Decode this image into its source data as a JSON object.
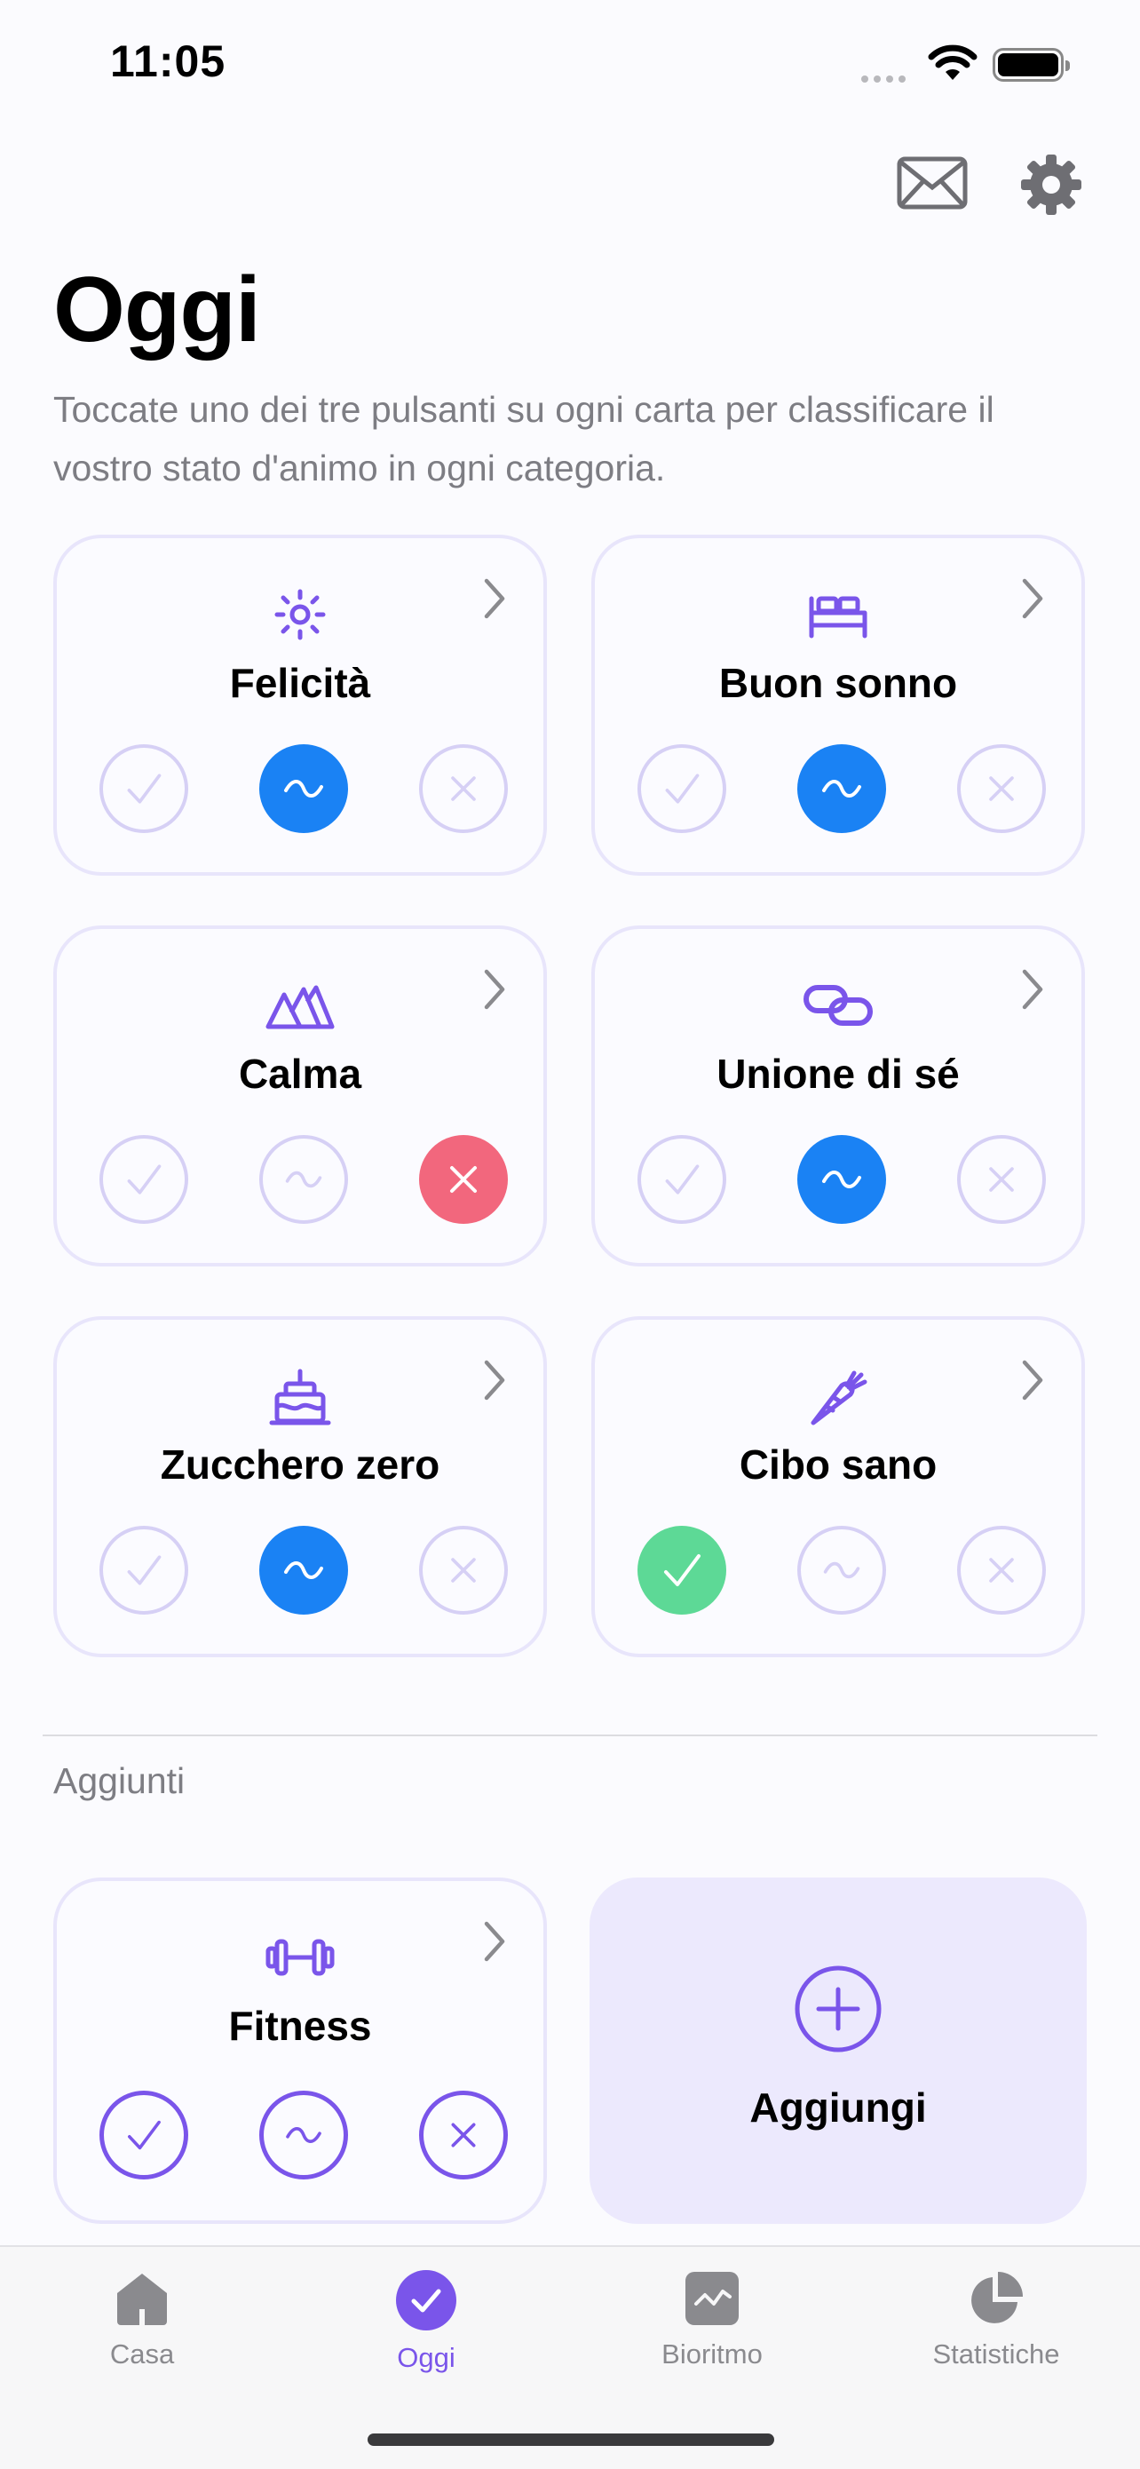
{
  "status_bar": {
    "time": "11:05"
  },
  "header": {
    "title": "Oggi",
    "subtitle": "Toccate uno dei tre pulsanti su ogni carta per classificare il vostro stato d'animo in ogni categoria."
  },
  "cards": [
    {
      "name": "Felicità",
      "icon": "sun-icon",
      "selected": "neutral"
    },
    {
      "name": "Buon sonno",
      "icon": "bed-icon",
      "selected": "neutral"
    },
    {
      "name": "Calma",
      "icon": "mountains-icon",
      "selected": "no"
    },
    {
      "name": "Unione di sé",
      "icon": "link-icon",
      "selected": "neutral"
    },
    {
      "name": "Zucchero zero",
      "icon": "cake-icon",
      "selected": "neutral"
    },
    {
      "name": "Cibo sano",
      "icon": "carrot-icon",
      "selected": "yes"
    }
  ],
  "added_section": {
    "label": "Aggiunti",
    "cards": [
      {
        "name": "Fitness",
        "icon": "dumbbell-icon",
        "selected": "none"
      }
    ],
    "add_label": "Aggiungi"
  },
  "tabbar": {
    "tabs": [
      {
        "label": "Casa",
        "icon": "house-icon"
      },
      {
        "label": "Oggi",
        "icon": "checkmark-circle-icon",
        "active": true
      },
      {
        "label": "Bioritmo",
        "icon": "chart-icon"
      },
      {
        "label": "Statistiche",
        "icon": "pie-chart-icon"
      }
    ]
  },
  "colors": {
    "accent": "#7a55ea",
    "neutral_selected": "#1a82f4",
    "no_selected": "#f2677d",
    "yes_selected": "#5dd996",
    "unselected_outline": "#d6d0f5"
  }
}
